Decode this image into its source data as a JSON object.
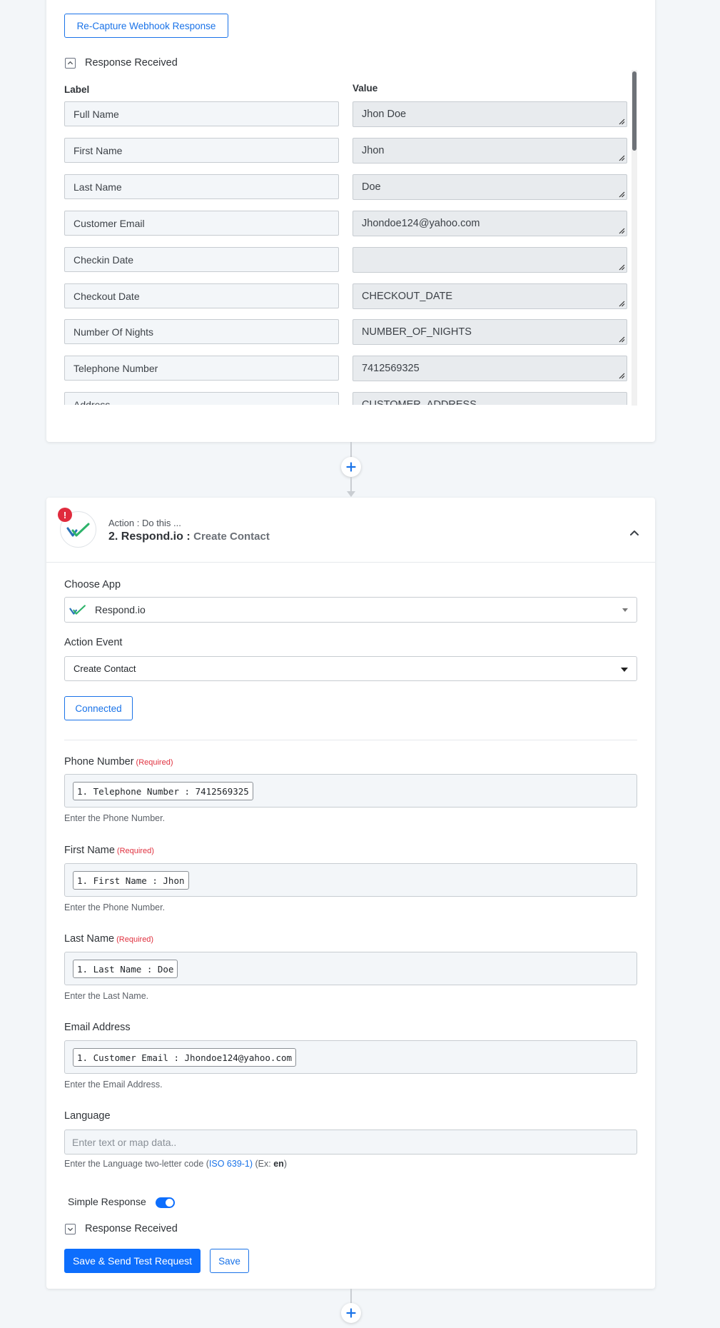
{
  "card1": {
    "recapture_label": "Re-Capture Webhook Response",
    "response_received_label": "Response Received",
    "col_label": "Label",
    "col_value": "Value",
    "rows": [
      {
        "label": "Full Name",
        "value": "Jhon Doe"
      },
      {
        "label": "First Name",
        "value": "Jhon"
      },
      {
        "label": "Last Name",
        "value": "Doe"
      },
      {
        "label": "Customer Email",
        "value": "Jhondoe124@yahoo.com"
      },
      {
        "label": "Checkin Date",
        "value": ""
      },
      {
        "label": "Checkout Date",
        "value": "CHECKOUT_DATE"
      },
      {
        "label": "Number Of Nights",
        "value": "NUMBER_OF_NIGHTS"
      },
      {
        "label": "Telephone Number",
        "value": "7412569325"
      },
      {
        "label": "Address",
        "value": "CUSTOMER_ADDRESS"
      }
    ]
  },
  "card2": {
    "error_badge": "!",
    "subtitle": "Action : Do this ...",
    "step_title": "2. Respond.io :",
    "action_name": "Create Contact",
    "choose_app_label": "Choose App",
    "app_value": "Respond.io",
    "action_event_label": "Action Event",
    "action_event_value": "Create Contact",
    "connected_label": "Connected",
    "required_text": "(Required)",
    "fields": {
      "phone": {
        "label": "Phone Number",
        "chip": "1. Telephone Number : 7412569325",
        "help": "Enter the Phone Number."
      },
      "first": {
        "label": "First Name",
        "chip": "1. First Name : Jhon",
        "help": "Enter the Phone Number."
      },
      "last": {
        "label": "Last Name",
        "chip": "1. Last Name : Doe",
        "help": "Enter the Last Name."
      },
      "email": {
        "label": "Email Address",
        "chip": "1. Customer Email : Jhondoe124@yahoo.com",
        "help": "Enter the Email Address."
      }
    },
    "language": {
      "label": "Language",
      "placeholder": "Enter text or map data..",
      "help_prefix": "Enter the Language two-letter code (",
      "help_link": "ISO 639-1)",
      "help_mid": " (Ex: ",
      "help_example": "en",
      "help_suffix": ")"
    },
    "simple_response_label": "Simple Response",
    "simple_response_on": true,
    "response_received_label": "Response Received",
    "save_send_label": "Save & Send Test Request",
    "save_label": "Save"
  },
  "colors": {
    "primary": "#0d6efd",
    "link": "#1a73e8",
    "error": "#e02b3d",
    "required": "#e0313f",
    "background": "#f3f6f9"
  }
}
